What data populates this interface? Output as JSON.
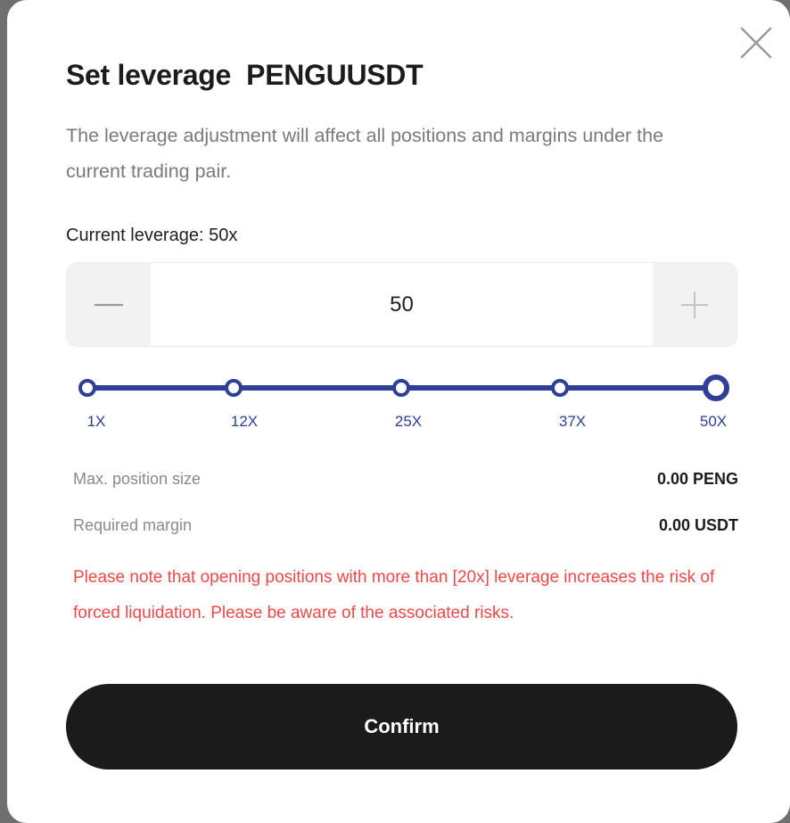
{
  "modal": {
    "title": "Set leverage  PENGUUSDT",
    "description": "The leverage adjustment will affect all positions and margins under the current trading pair.",
    "current_leverage": "Current leverage: 50x",
    "close_icon": "close-icon"
  },
  "stepper": {
    "value": "50",
    "minus_icon": "minus-icon",
    "plus_icon": "plus-icon"
  },
  "slider": {
    "marks": [
      "1X",
      "12X",
      "25X",
      "37X",
      "50X"
    ],
    "selected": "50X",
    "accent_color": "#2f3f98"
  },
  "info": {
    "max_position_label": "Max. position size",
    "max_position_value": "0.00 PENG",
    "required_margin_label": "Required margin",
    "required_margin_value": "0.00 USDT"
  },
  "warning": "Please note that opening positions with more than [20x] leverage increases the risk of forced liquidation. Please be aware of the associated risks.",
  "warning_color": "#f04848",
  "confirm_label": "Confirm"
}
